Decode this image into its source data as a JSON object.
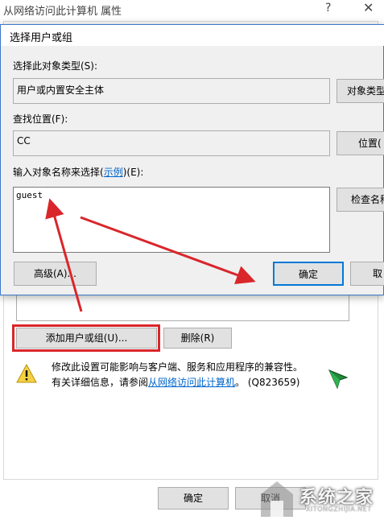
{
  "background_window": {
    "title": "从网络访问此计算机 属性",
    "help_glyph": "?",
    "close_glyph": "✕",
    "add_button": "添加用户或组(U)...",
    "remove_button": "删除(R)",
    "warning_line1": "修改此设置可能影响与客户端、服务和应用程序的兼容性。",
    "warning_line2_prefix": "有关详细信息，请参阅",
    "warning_link": "从网络访问此计算机",
    "warning_line2_suffix": "。 (Q823659)",
    "ok_button": "确定",
    "cancel_button": "取消"
  },
  "dialog": {
    "title": "选择用户或组",
    "object_type_label": "选择此对象类型(S):",
    "object_type_value": "用户或内置安全主体",
    "object_type_button": "对象类型",
    "location_label": "查找位置(F):",
    "location_value": "CC",
    "location_button": "位置(",
    "names_label_prefix": "输入对象名称来选择(",
    "names_label_link": "示例",
    "names_label_suffix": ")(E):",
    "names_value": "guest",
    "check_names_button": "检查名称",
    "advanced_button": "高级(A)...",
    "ok_button": "确定",
    "cancel_button": "取"
  },
  "watermark": {
    "text": "系统之家",
    "subtext": "XITONGZHIJIA.NET"
  },
  "icons": {
    "warning": "warning-icon",
    "cursor": "busy-cursor-icon"
  },
  "colors": {
    "annotation_red": "#d9262b",
    "dialog_border": "#3c78c8",
    "link_blue": "#0066cc"
  }
}
